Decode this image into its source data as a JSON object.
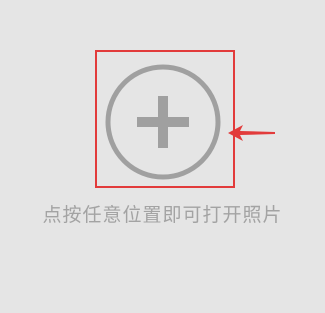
{
  "picker": {
    "hint_text": "点按任意位置即可打开照片",
    "icon": "plus-circle-icon",
    "icon_color": "#a0a0a0",
    "background_color": "#e5e5e5"
  },
  "annotation": {
    "highlight_color": "#e23b3b",
    "arrow_icon": "left-arrow-icon"
  }
}
